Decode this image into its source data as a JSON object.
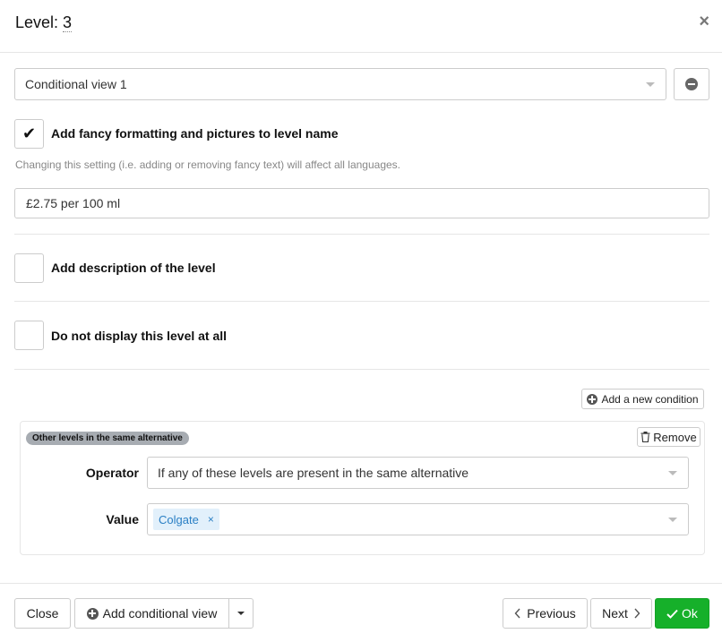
{
  "header": {
    "title_prefix": "Level: ",
    "title_number": "3",
    "close_glyph": "×"
  },
  "view_select": {
    "value": "Conditional view 1"
  },
  "fancy_formatting": {
    "checked": true,
    "check_glyph": "✔",
    "label": "Add fancy formatting and pictures to level name",
    "help_text": "Changing this setting (i.e. adding or removing fancy text) will affect all languages."
  },
  "level_name_input": {
    "value": "£2.75 per 100 ml"
  },
  "add_description": {
    "checked": false,
    "label": "Add description of the level"
  },
  "do_not_display": {
    "checked": false,
    "label": "Do not display this level at all"
  },
  "add_condition_button": {
    "label": "Add a new condition"
  },
  "condition": {
    "badge": "Other levels in the same alternative",
    "remove_label": "Remove",
    "operator_label": "Operator",
    "operator_value": "If any of these levels are present in the same alternative",
    "value_label": "Value",
    "value_tags": [
      {
        "text": "Colgate",
        "remove_glyph": "×"
      }
    ]
  },
  "footer": {
    "close_label": "Close",
    "add_view_label": "Add conditional view",
    "previous_label": "Previous",
    "next_label": "Next",
    "ok_label": "Ok"
  },
  "colors": {
    "ok_green": "#16b02a",
    "tag_bg": "#e2f0fb",
    "tag_text": "#2a7fc4",
    "badge_bg": "#a7acb2"
  },
  "icons": [
    "close-icon",
    "minus-circle-icon",
    "checkmark-icon",
    "plus-circle-icon",
    "trash-icon",
    "chevron-left-icon",
    "chevron-right-icon",
    "caret-down-icon"
  ]
}
